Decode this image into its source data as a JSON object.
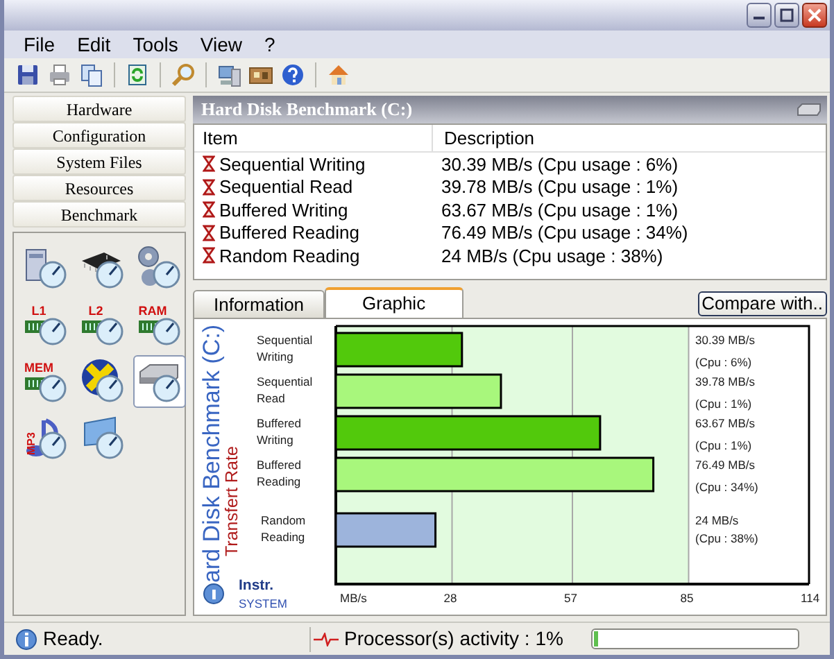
{
  "menu": [
    "File",
    "Edit",
    "Tools",
    "View",
    "?"
  ],
  "sidebar": {
    "sections": [
      "Hardware",
      "Configuration",
      "System Files",
      "Resources",
      "Benchmark"
    ],
    "icons": [
      {
        "kind": "computer",
        "selected": false
      },
      {
        "kind": "chip",
        "selected": false
      },
      {
        "kind": "gears",
        "selected": false
      },
      {
        "kind": "memory",
        "label": "L1",
        "selected": false
      },
      {
        "kind": "memory",
        "label": "L2",
        "selected": false
      },
      {
        "kind": "memory",
        "label": "RAM",
        "selected": false
      },
      {
        "kind": "memory",
        "label": "MEM",
        "selected": false
      },
      {
        "kind": "cross",
        "selected": false
      },
      {
        "kind": "harddisk",
        "selected": true
      },
      {
        "kind": "mp3",
        "label": "MP3",
        "selected": false
      },
      {
        "kind": "game",
        "selected": false
      }
    ]
  },
  "panel": {
    "title": "Hard Disk Benchmark (C:)",
    "table": {
      "columns": [
        "Item",
        "Description"
      ],
      "rows": [
        [
          "Sequential Writing",
          "30.39 MB/s (Cpu usage : 6%)"
        ],
        [
          "Sequential Read",
          "39.78 MB/s  (Cpu usage : 1%)"
        ],
        [
          "Buffered Writing",
          "63.67 MB/s  (Cpu usage : 1%)"
        ],
        [
          "Buffered Reading",
          "76.49 MB/s  (Cpu usage : 34%)"
        ],
        [
          "Random Reading",
          "24 MB/s  (Cpu usage : 38%)"
        ]
      ]
    },
    "tabs": [
      {
        "label": "Information",
        "selected": false
      },
      {
        "label": "Graphic",
        "selected": true
      }
    ],
    "compare_button": "Compare with..",
    "chart_data": {
      "type": "bar",
      "orientation": "horizontal",
      "title": "ard Disk Benchmark (C:)",
      "annotations": [
        {
          "text": "Transfert Rate"
        }
      ],
      "grid": true,
      "bands": [
        {
          "axis": "x",
          "from": 0,
          "to": 85,
          "color": "#e2fbdf"
        }
      ],
      "categories": [
        [
          "Sequential",
          "Writing"
        ],
        [
          "Sequential",
          "Read"
        ],
        [
          "Buffered",
          "Writing"
        ],
        [
          "Buffered",
          "Reading"
        ],
        [
          "Random",
          "Reading"
        ]
      ],
      "values": [
        30.39,
        39.78,
        63.67,
        76.49,
        24
      ],
      "colors": [
        "#52c90c",
        "#a8f77c",
        "#52c90c",
        "#a8f77c",
        "#9db4dc"
      ],
      "value_labels": [
        [
          "30.39  MB/s",
          "(Cpu : 6%)"
        ],
        [
          "39.78  MB/s",
          "(Cpu : 1%)"
        ],
        [
          "63.67  MB/s",
          "(Cpu : 1%)"
        ],
        [
          "76.49  MB/s",
          "(Cpu : 34%)"
        ],
        [
          "24 MB/s",
          "(Cpu : 38%)"
        ]
      ],
      "xlim": [
        0,
        114
      ],
      "xticks": [
        {
          "value": 0,
          "label": "MB/s"
        },
        28,
        57,
        85,
        114
      ]
    },
    "chart_logo": [
      "Instr.",
      "SYSTEM"
    ]
  },
  "status_bar": {
    "message": "Ready.",
    "activity": "Processor(s) activity : 1%",
    "level": 0.02
  }
}
